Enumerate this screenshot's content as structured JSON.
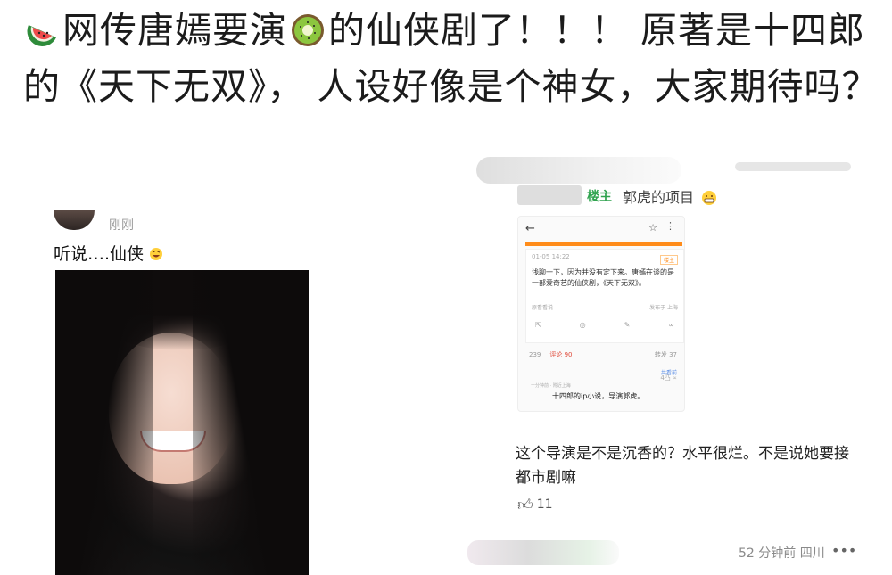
{
  "post": {
    "text_1": "网传唐嫣要演",
    "text_2": "的仙侠剧了！！！ 原著是十四郎的《天下无双》， 人设好像是个神女，大家期待吗？",
    "emoji_1": "watermelon-icon",
    "emoji_2": "kiwi-icon"
  },
  "left_shot": {
    "time": "刚刚",
    "text": "听说….仙侠",
    "emoji": "laughing-emoji-icon"
  },
  "right_shot": {
    "owner_tag": "楼主",
    "owner_name": "郭虎的项目",
    "inner": {
      "date": "01-05 14:22",
      "tag": "楼主",
      "body": "浅聊一下，因为并没有定下来。唐嫣在谈的是一部爱奇艺的仙侠剧，《天下无双》。",
      "source": "原看看说",
      "location": "发布于 上海",
      "stats_count": "239",
      "comments_label": "评论 90",
      "likes": "转发 37",
      "more": "共看前",
      "reply_meta": "十分钟前 · 附近上海",
      "reply_actions": "4凸 ∝",
      "reply": "十四郎的ip小说，导演郭虎。"
    },
    "comment": "这个导演是不是沉香的？水平很烂。不是说她要接都市剧嘛",
    "like_count": "11",
    "bottom_time": "52 分钟前 四川",
    "more_label": "•••"
  },
  "colors": {
    "owner_green": "#2fa34e",
    "accent_orange": "#ff8c1a",
    "comment_red": "#e04a3a"
  }
}
